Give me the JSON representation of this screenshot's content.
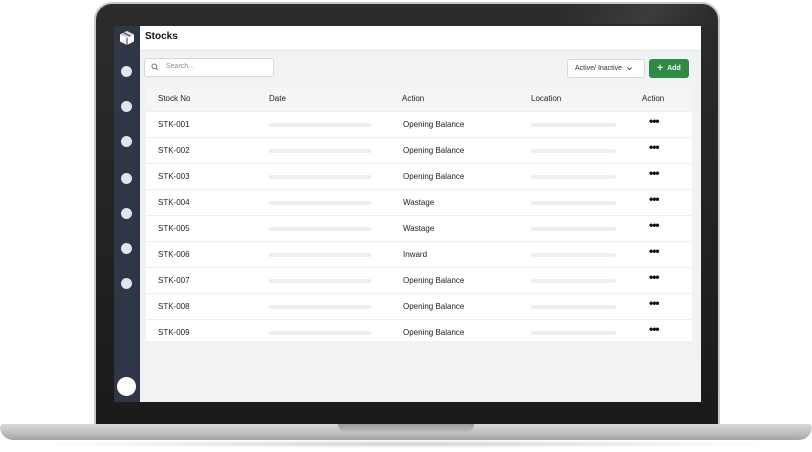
{
  "app": {
    "title": "Stocks"
  },
  "toolbar": {
    "search_placeholder": "Search...",
    "status_filter": "Active/ Inactive",
    "add_label": "Add",
    "add_icon": "plus-icon"
  },
  "colors": {
    "sidebar": "#2f3645",
    "accent_green": "#2e8b45",
    "screen_bg": "#f1f2f4"
  },
  "table": {
    "columns": [
      "Stock No",
      "Date",
      "Action",
      "Location",
      "Action"
    ],
    "rows": [
      {
        "stock_no": "STK-001",
        "action": "Opening Balance"
      },
      {
        "stock_no": "STK-002",
        "action": "Opening Balance"
      },
      {
        "stock_no": "STK-003",
        "action": "Opening Balance"
      },
      {
        "stock_no": "STK-004",
        "action": "Wastage"
      },
      {
        "stock_no": "STK-005",
        "action": "Wastage"
      },
      {
        "stock_no": "STK-006",
        "action": "Inward"
      },
      {
        "stock_no": "STK-007",
        "action": "Opening Balance"
      },
      {
        "stock_no": "STK-008",
        "action": "Opening Balance"
      },
      {
        "stock_no": "STK-009",
        "action": "Opening Balance"
      }
    ],
    "row_menu_glyph": "•••"
  }
}
